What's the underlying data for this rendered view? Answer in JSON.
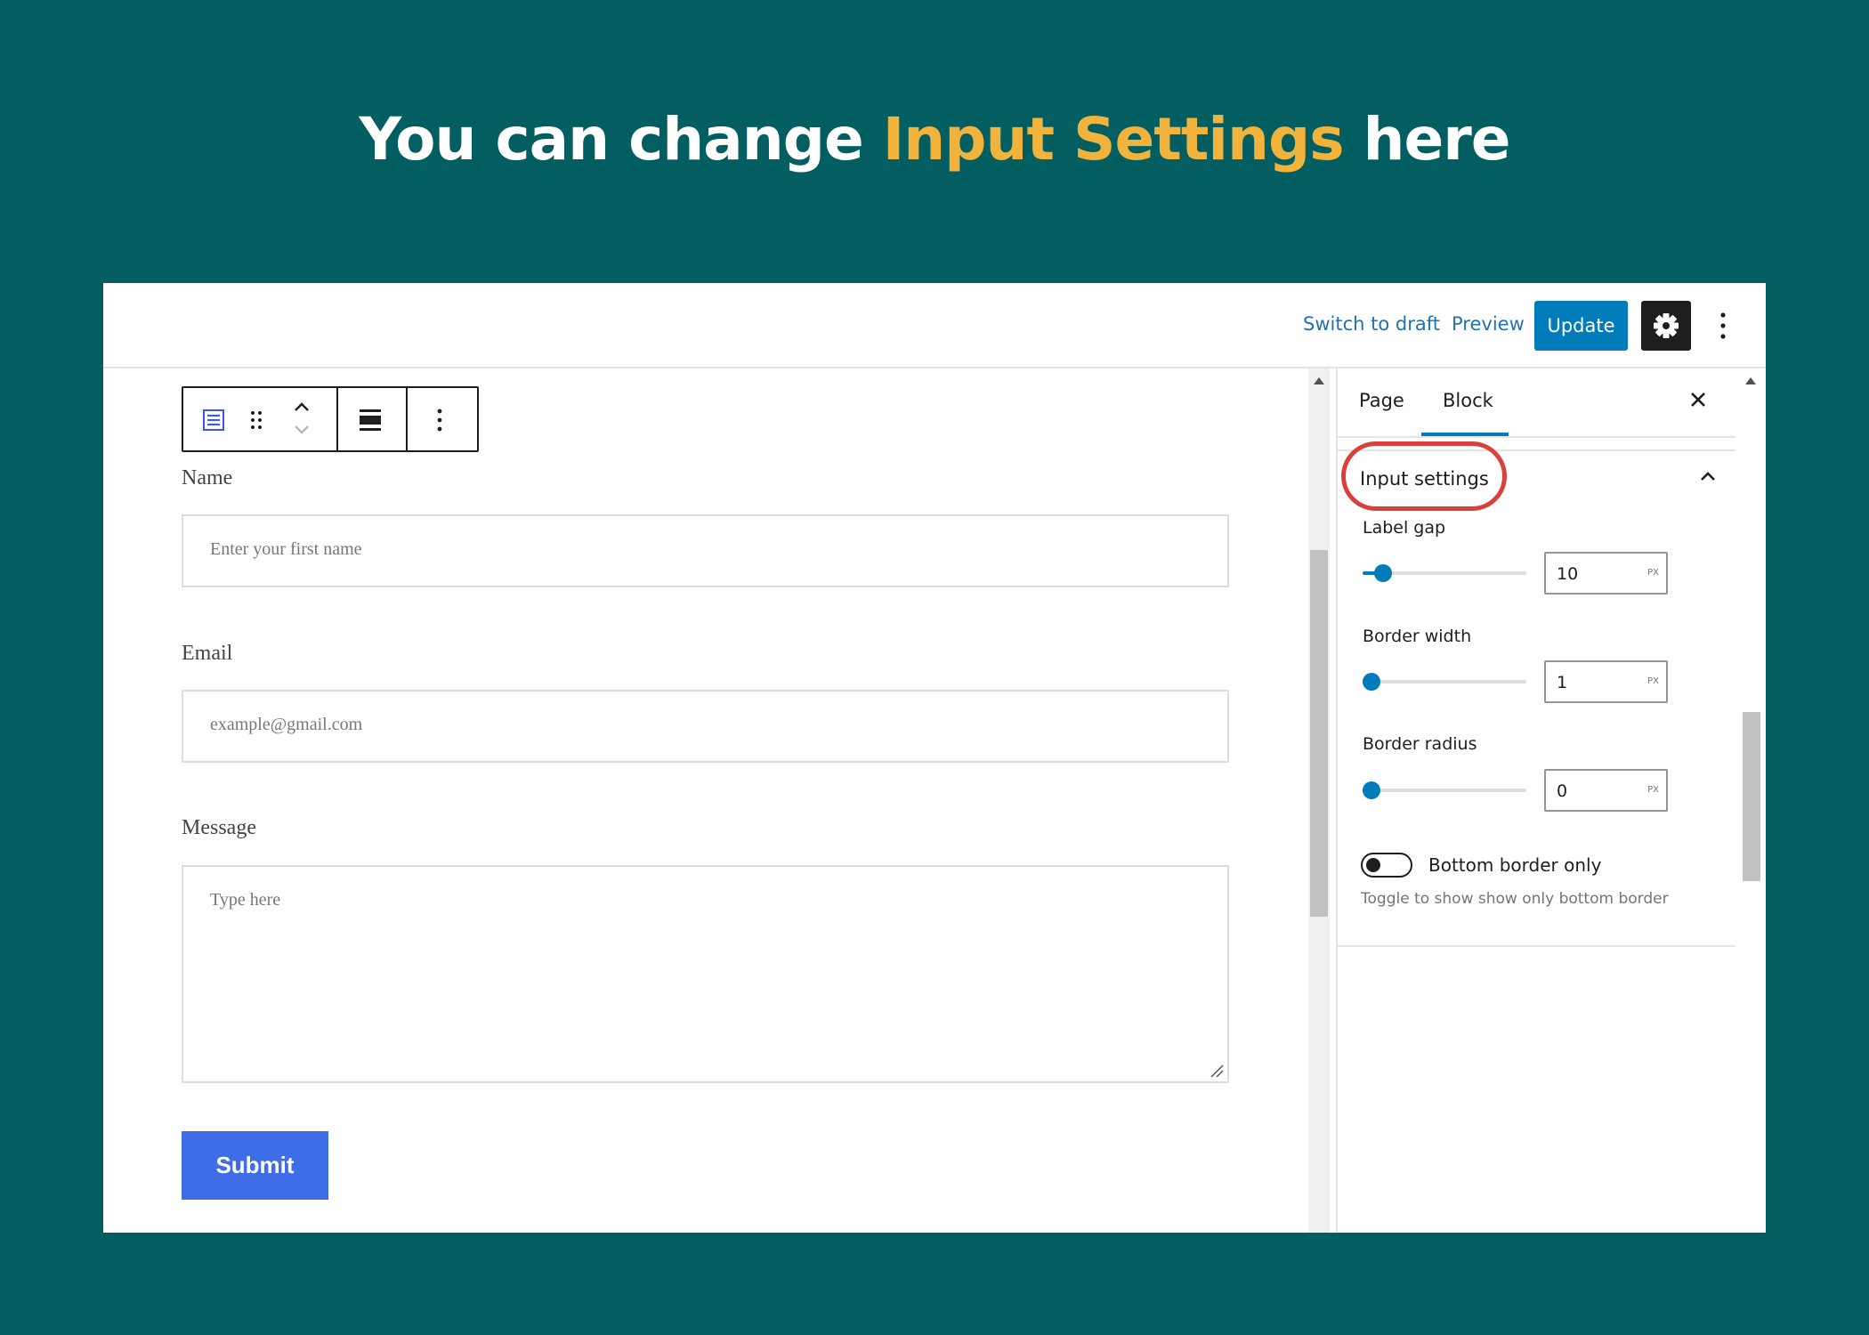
{
  "headline": {
    "prefix": "You can change ",
    "accent": "Input Settings",
    "suffix": " here"
  },
  "topbar": {
    "switch_to_draft": "Switch to draft",
    "preview": "Preview",
    "update": "Update",
    "settings_icon": "gear-icon",
    "options_icon": "more-vertical-icon"
  },
  "block_toolbar": {
    "icons": [
      "form-block-icon",
      "drag-handle-icon",
      "move-up-icon",
      "move-down-icon",
      "align-icon",
      "more-vertical-icon"
    ]
  },
  "form": {
    "fields": [
      {
        "label": "Name",
        "placeholder": "Enter your first name"
      },
      {
        "label": "Email",
        "placeholder": "example@gmail.com"
      },
      {
        "label": "Message",
        "placeholder": "Type here"
      }
    ],
    "submit_label": "Submit"
  },
  "sidebar": {
    "tabs": [
      {
        "label": "Page",
        "active": false
      },
      {
        "label": "Block",
        "active": true
      }
    ],
    "panel": {
      "title": "Input settings",
      "controls": [
        {
          "label": "Label gap",
          "value": "10",
          "unit": "PX",
          "fraction": 0.08
        },
        {
          "label": "Border width",
          "value": "1",
          "unit": "PX",
          "fraction": 0.0
        },
        {
          "label": "Border radius",
          "value": "0",
          "unit": "PX",
          "fraction": 0.0
        }
      ],
      "toggle": {
        "label": "Bottom border only",
        "checked": false,
        "help": "Toggle to show show only bottom border"
      }
    }
  },
  "colors": {
    "background": "#035e61",
    "accent": "#f2b33d",
    "wp_blue": "#007cba",
    "submit": "#3f6ce7",
    "highlight": "#d9403d"
  }
}
